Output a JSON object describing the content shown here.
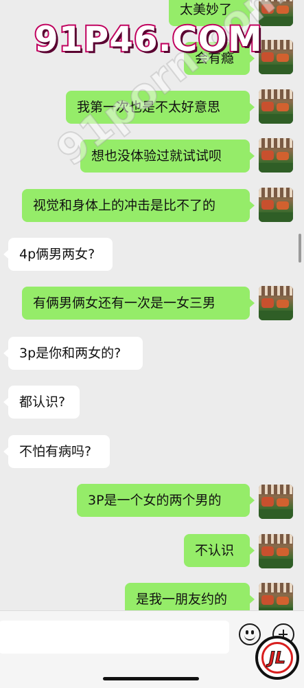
{
  "watermark": {
    "main": "91P46.COM",
    "diagonal": "91porn.com"
  },
  "colors": {
    "outgoing_bubble": "#95ec69",
    "incoming_bubble": "#ffffff",
    "background": "#ececec"
  },
  "messages": [
    {
      "side": "out",
      "text": "太美妙了"
    },
    {
      "side": "out",
      "text": "会有瘾"
    },
    {
      "side": "out",
      "text": "我第一次也是不太好意思"
    },
    {
      "side": "out",
      "text": "想也没体验过就试试呗"
    },
    {
      "side": "out",
      "text": "视觉和身体上的冲击是比不了的"
    },
    {
      "side": "in",
      "text": "4p俩男两女?"
    },
    {
      "side": "out",
      "text": "有俩男俩女还有一次是一女三男"
    },
    {
      "side": "in",
      "text": "3p是你和两女的?"
    },
    {
      "side": "in",
      "text": "都认识?"
    },
    {
      "side": "in",
      "text": "不怕有病吗?"
    },
    {
      "side": "out",
      "text": "3P是一个女的两个男的"
    },
    {
      "side": "out",
      "text": "不认识"
    },
    {
      "side": "out",
      "text": "是我一朋友约的"
    }
  ],
  "input_bar": {
    "input_value": "",
    "emoji_icon": "emoji-icon",
    "plus_icon": "plus-icon"
  },
  "logo": {
    "text": "JL"
  }
}
